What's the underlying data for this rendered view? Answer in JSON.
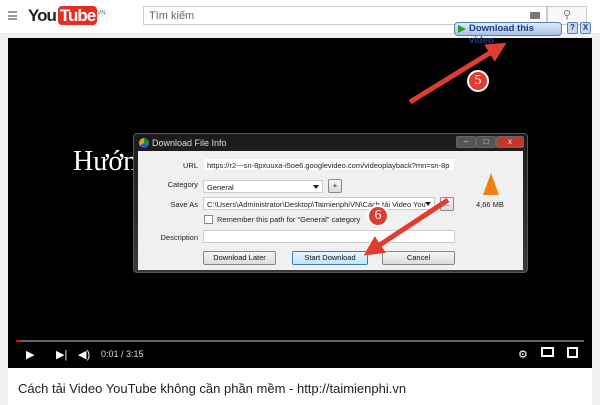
{
  "header": {
    "logo_you": "You",
    "logo_tube": "Tube",
    "logo_region": "VN",
    "search_placeholder": "Tìm kiếm",
    "search_icon": "search-icon"
  },
  "idm_bar": {
    "label": "Download this video",
    "help": "?",
    "close": "X"
  },
  "video": {
    "overlay_title": "Hướng",
    "time": "0:01 / 3:15",
    "progress": 0.005
  },
  "dialog": {
    "title": "Download File Info",
    "url_label": "URL",
    "url": "https://r2---sn-8pxuuxa-i5oe6.googlevideo.com/videoplayback?mn=sn-8p",
    "category_label": "Category",
    "category": "General",
    "add": "+",
    "saveas_label": "Save As",
    "saveas": "C:\\Users\\Administrator\\Desktop\\TaimienphiVN\\Cách tải Video You",
    "browse": "...",
    "remember": "Remember this path for \"General\" category",
    "description_label": "Description",
    "description": "",
    "size": "4,66  MB",
    "download_later": "Download Later",
    "start_download": "Start Download",
    "cancel": "Cancel"
  },
  "annotations": {
    "step5": "5",
    "step6": "6",
    "arrow_color": "#e03c32"
  },
  "page": {
    "video_title": "Cách tải Video YouTube không cần phần mềm - http://taimienphi.vn"
  }
}
